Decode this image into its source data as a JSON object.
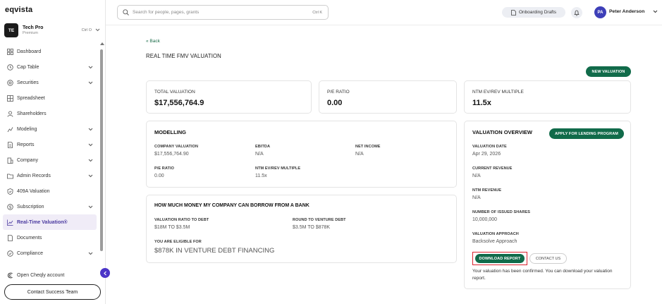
{
  "app": {
    "logo": "eqvista"
  },
  "org": {
    "initials": "TE",
    "name": "Tech Pro",
    "plan": "Premium",
    "shortcut": "Ctrl O"
  },
  "sidebar": {
    "items": [
      {
        "label": "Dashboard",
        "icon": "dashboard-icon",
        "chevron": false
      },
      {
        "label": "Cap Table",
        "icon": "cap-table-icon",
        "chevron": true
      },
      {
        "label": "Securities",
        "icon": "securities-icon",
        "chevron": true
      },
      {
        "label": "Spreadsheet",
        "icon": "spreadsheet-icon",
        "chevron": false
      },
      {
        "label": "Shareholders",
        "icon": "shareholders-icon",
        "chevron": false
      },
      {
        "label": "Modeling",
        "icon": "modeling-icon",
        "chevron": true
      },
      {
        "label": "Reports",
        "icon": "reports-icon",
        "chevron": true
      },
      {
        "label": "Company",
        "icon": "company-icon",
        "chevron": true
      },
      {
        "label": "Admin Records",
        "icon": "admin-records-icon",
        "chevron": true
      },
      {
        "label": "409A Valuation",
        "icon": "valuation-icon",
        "chevron": false
      },
      {
        "label": "Subscription",
        "icon": "subscription-icon",
        "chevron": true
      },
      {
        "label": "Real-Time Valuation®",
        "icon": "chart-line-icon",
        "chevron": false,
        "active": true
      },
      {
        "label": "Documents",
        "icon": "documents-icon",
        "chevron": false
      },
      {
        "label": "Compliance",
        "icon": "compliance-icon",
        "chevron": true
      }
    ],
    "cheqly": "Open Cheqly account",
    "contact_success": "Contact Success Team"
  },
  "topbar": {
    "search_placeholder": "Search for people, pages, grants",
    "search_shortcut": "Ctrl K",
    "drafts_label": "Onboarding Drafts",
    "user_initials": "PA",
    "user_name": "Peter Anderson"
  },
  "main": {
    "back": "« Back",
    "title": "REAL TIME FMV VALUATION",
    "new_valuation": "NEW VALUATION",
    "kpis": {
      "total": {
        "label": "TOTAL VALUATION",
        "value": "$17,556,764.9"
      },
      "pe": {
        "label": "P/E RATIO",
        "value": "0.00"
      },
      "ntm": {
        "label": "NTM EV/REV MULTIPLE",
        "value": "11.5x"
      }
    },
    "modelling": {
      "title": "MODELLING",
      "company_valuation": {
        "label": "COMPANY VALUATION",
        "value": "$17,556,764.90"
      },
      "ebitda": {
        "label": "EBITDA",
        "value": "N/A"
      },
      "net_income": {
        "label": "NET INCOME",
        "value": "N/A"
      },
      "pe_ratio": {
        "label": "P/E RATIO",
        "value": "0.00"
      },
      "ntm_multiple": {
        "label": "NTM EV/REV MULTIPLE",
        "value": "11.5x"
      }
    },
    "bank": {
      "title": "HOW MUCH MONEY MY COMPANY CAN BORROW FROM A BANK",
      "ratio": {
        "label": "VALUATION RATIO TO DEBT",
        "value": "$18M TO $3.5M"
      },
      "round": {
        "label": "ROUND TO VENTURE DEBT",
        "value": "$3.5M TO $878K"
      },
      "eligible": {
        "label": "YOU ARE ELIGIBLE FOR",
        "value": "$878K IN VENTURE DEBT FINANCING"
      }
    },
    "overview": {
      "title": "VALUATION OVERVIEW",
      "apply": "APPLY FOR LENDING PROGRAM",
      "date": {
        "label": "VALUATION DATE",
        "value": "Apr 29, 2026"
      },
      "current_revenue": {
        "label": "CURRENT REVENUE",
        "value": "N/A"
      },
      "ntm_revenue": {
        "label": "NTM REVENUE",
        "value": "N/A"
      },
      "shares": {
        "label": "NUMBER OF ISSUED SHARES",
        "value": "10,000,000"
      },
      "approach": {
        "label": "VALUATION APPROACH",
        "value": "Backsolve Approach"
      },
      "download": "DOWNLOAD REPORT",
      "contact_us": "CONTACT US",
      "confirm": "Your valuation has been confirmed. You can download your valuation report."
    }
  },
  "colors": {
    "brand_green": "#116b4a",
    "accent_purple": "#4b35c8",
    "highlight_red": "#d9232e"
  }
}
